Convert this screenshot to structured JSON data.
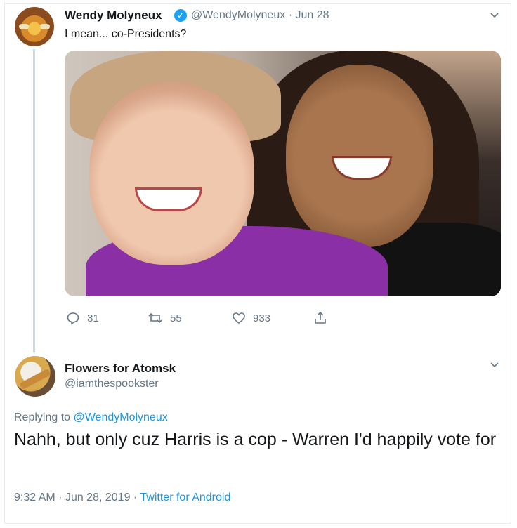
{
  "tweet1": {
    "author_name": "Wendy Molyneux",
    "handle": "@WendyMolyneux",
    "date": "Jun 28",
    "text": "I mean... co-Presidents?",
    "actions": {
      "replies": "31",
      "retweets": "55",
      "likes": "933"
    }
  },
  "tweet2": {
    "author_name": "Flowers for Atomsk",
    "handle": "@iamthespookster",
    "replying_label": "Replying to",
    "replying_to": "@WendyMolyneux",
    "text": "Nahh, but only cuz Harris is a cop - Warren I'd happily vote for",
    "time": "9:32 AM",
    "date": "Jun 28, 2019",
    "source": "Twitter for Android"
  },
  "icons": {
    "verified": "verified-badge-icon",
    "menu": "chevron-down-icon",
    "reply": "reply-icon",
    "retweet": "retweet-icon",
    "like": "heart-icon",
    "share": "share-icon"
  },
  "colors": {
    "link": "#1b95e0",
    "muted": "#657786",
    "verified": "#1da1f2"
  }
}
